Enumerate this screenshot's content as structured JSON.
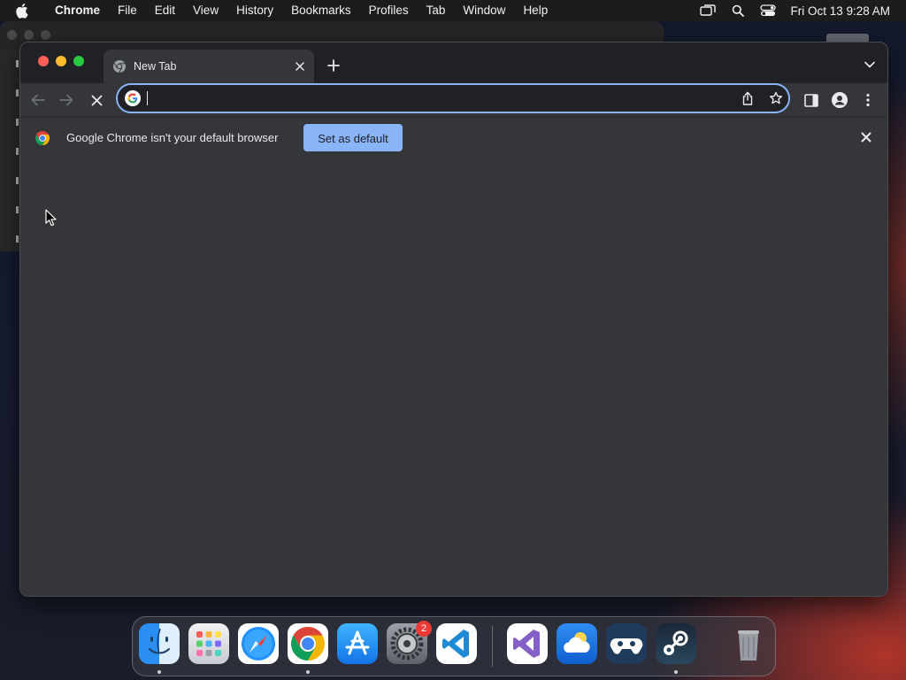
{
  "menubar": {
    "app_name": "Chrome",
    "items": [
      "File",
      "Edit",
      "View",
      "History",
      "Bookmarks",
      "Profiles",
      "Tab",
      "Window",
      "Help"
    ],
    "clock": "Fri Oct 13  9:28 AM"
  },
  "browser": {
    "tab": {
      "title": "New Tab"
    },
    "omnibox": {
      "value": "",
      "placeholder": ""
    },
    "infobar": {
      "message": "Google Chrome isn't your default browser",
      "button_label": "Set as default"
    }
  },
  "dock": {
    "apps": [
      {
        "name": "Finder",
        "icon": "finder-icon",
        "running": true
      },
      {
        "name": "Launchpad",
        "icon": "launchpad-icon",
        "running": false
      },
      {
        "name": "Safari",
        "icon": "safari-icon",
        "running": false
      },
      {
        "name": "Google Chrome",
        "icon": "chrome-icon",
        "running": true
      },
      {
        "name": "App Store",
        "icon": "app-store-icon",
        "running": false
      },
      {
        "name": "System Settings",
        "icon": "system-settings-icon",
        "running": false,
        "badge": "2"
      },
      {
        "name": "Visual Studio Code",
        "icon": "vscode-icon",
        "running": false
      },
      {
        "name": "Visual Studio",
        "icon": "visual-studio-icon",
        "running": false
      },
      {
        "name": "Weather",
        "icon": "weather-icon",
        "running": false
      },
      {
        "name": "Game Controller",
        "icon": "game-controller-icon",
        "running": false
      },
      {
        "name": "Steam",
        "icon": "steam-icon",
        "running": true
      },
      {
        "name": "Trash",
        "icon": "trash-icon",
        "running": false
      }
    ]
  },
  "colors": {
    "accent": "#8ab4f8",
    "chrome_bg": "#35363a",
    "tabstrip_bg": "#202124",
    "close_red": "#ff5f57",
    "minimize_yellow": "#febc2e",
    "zoom_green": "#28c840"
  }
}
